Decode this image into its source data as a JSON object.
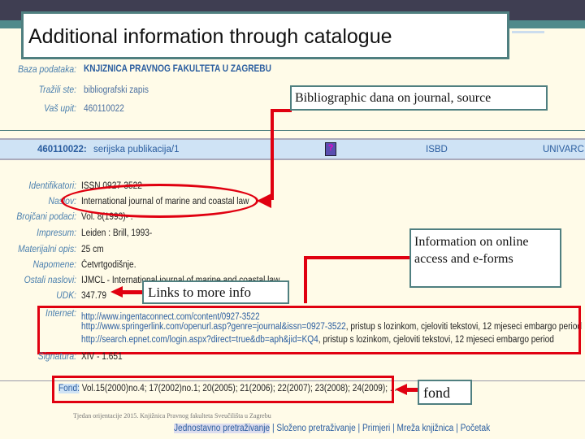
{
  "slide": {
    "title": "Additional information through catalogue"
  },
  "catalogue": {
    "search_info": [
      {
        "label": "Baza podataka:",
        "value": "KNJIZNICA PRAVNOG FAKULTETA U ZAGREBU"
      },
      {
        "label": "Tražili ste:",
        "value": "bibliografski zapis"
      },
      {
        "label": "Vaš upit:",
        "value": "460110022"
      }
    ],
    "record_header": {
      "id": "460110022:",
      "type": "serijska publikacija/1",
      "isbd": "ISBD",
      "univarc": "UNIVARC",
      "icon": "help-book-icon"
    },
    "fields": [
      {
        "label": "Identifikatori:",
        "value": "ISSN 0927-3522"
      },
      {
        "label": "Naslov:",
        "value": "International journal of marine and coastal law"
      },
      {
        "label": "Brojčani podaci:",
        "value": "Vol. 8(1993)- ."
      },
      {
        "label": "Impresum:",
        "value": "Leiden : Brill, 1993-"
      },
      {
        "label": "Materijalni opis:",
        "value": "25 cm"
      },
      {
        "label": "Napomene:",
        "value": "Četvrtgodišnje."
      },
      {
        "label": "Ostali naslovi:",
        "value": "IJMCL - International journal of marine and coastal law"
      },
      {
        "label": "UDK:",
        "value": "347.79"
      }
    ],
    "internet": {
      "label": "Internet:",
      "links": [
        {
          "url": "http://www.ingentaconnect.com/content/0927-3522",
          "note": ""
        },
        {
          "url": "http://www.springerlink.com/openurl.asp?genre=journal&issn=0927-3522",
          "note": ", pristup s lozinkom, cjeloviti tekstovi, 12 mjeseci embargo period"
        },
        {
          "url": "http://search.epnet.com/login.aspx?direct=true&db=aph&jid=KQ4",
          "note": ", pristup s lozinkom, cjeloviti tekstovi, 12 mjeseci embargo period"
        }
      ]
    },
    "signatura": {
      "label": "Signatura:",
      "value": "XIV - 1.651"
    },
    "fond": {
      "label": "Fond:",
      "value": "Vol.15(2000)no.4; 17(2002)no.1; 20(2005); 21(2006); 22(2007); 23(2008); 24(2009); ..."
    },
    "footer_text": "Tjedan orijentacije 2015. Knjižnica Pravnog fakulteta Sveučilišta u Zagrebu",
    "nav": [
      "Jednostavno pretraživanje",
      "Složeno pretraživanje",
      "Primjeri",
      "Mreža knjižnica",
      "Početak"
    ]
  },
  "callouts": {
    "bibliographic": "Bibliographic dana on journal, source",
    "online": "Information on online access and e-forms",
    "links": "Links to more info",
    "fond": "fond"
  },
  "colors": {
    "annotation": "#e00010",
    "frame": "#4f7f80",
    "label": "#4a7fae"
  }
}
